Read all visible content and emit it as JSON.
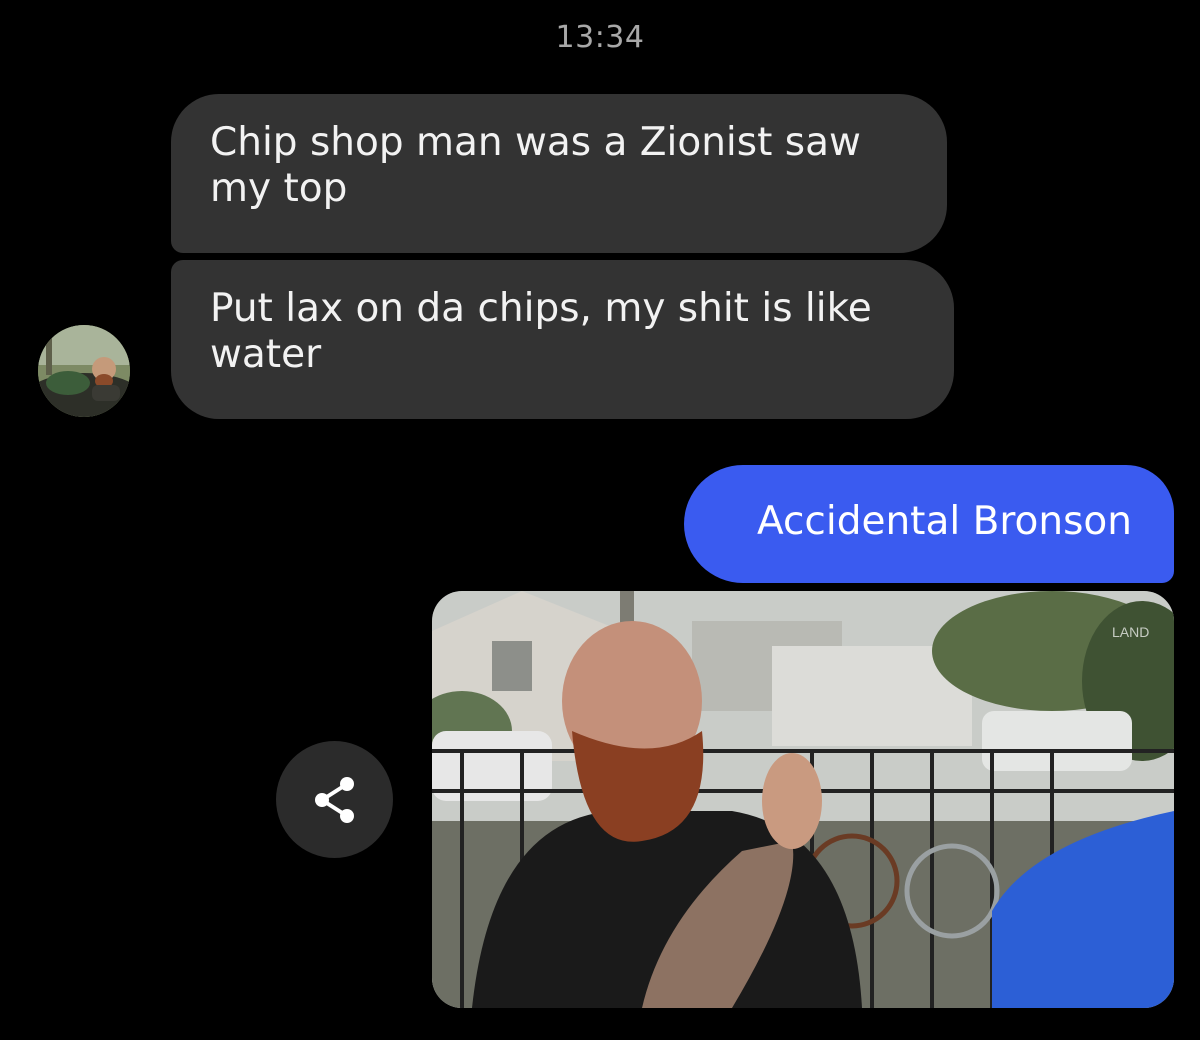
{
  "conversation": {
    "timestamp": "13:34",
    "incoming": [
      {
        "text": "Chip shop man was a Zionist saw my top"
      },
      {
        "text": "Put lax on da chips, my shit is like water"
      }
    ],
    "outgoing": [
      {
        "text": "Accidental Bronson"
      }
    ],
    "media": {
      "kind": "gif-image",
      "watermark": "LAND"
    }
  },
  "icons": {
    "avatar": "contact-avatar",
    "share": "share-icon"
  },
  "colors": {
    "background": "#000000",
    "incoming_bubble": "#333333",
    "outgoing_bubble": "#3a5bf0",
    "timestamp_text": "#a8a8a8",
    "share_button": "#2b2b2b"
  }
}
